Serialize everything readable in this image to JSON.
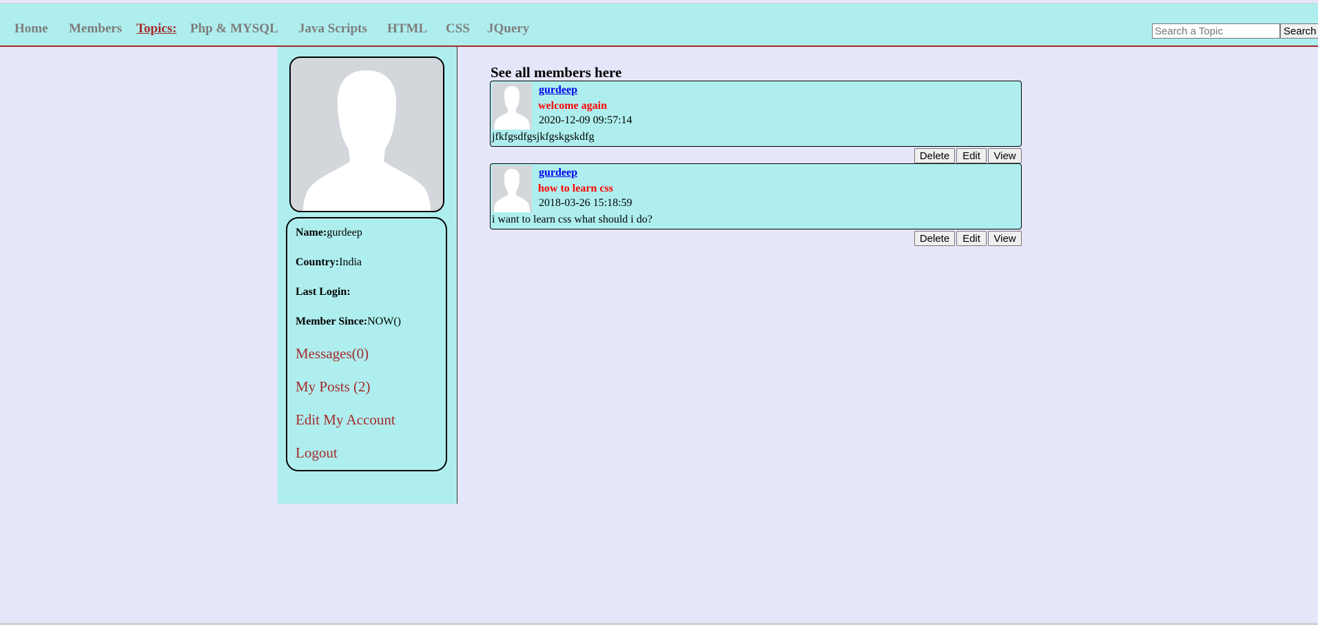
{
  "nav": {
    "home": "Home",
    "members": "Members",
    "topics": "Topics:",
    "php": "Php & MYSQL",
    "javascripts": "Java Scripts",
    "html": "HTML",
    "css": "CSS",
    "jquery": "JQuery"
  },
  "search": {
    "placeholder": "Search a Topic",
    "button": "Search"
  },
  "profile": {
    "name_label": "Name:",
    "name_value": "gurdeep",
    "country_label": "Country:",
    "country_value": "India",
    "last_login_label": "Last Login:",
    "last_login_value": "",
    "member_since_label": "Member Since:",
    "member_since_value": "NOW()",
    "links": {
      "messages": "Messages(0)",
      "my_posts": "My Posts (2)",
      "edit_account": "Edit My Account",
      "logout": "Logout"
    }
  },
  "main": {
    "heading": "See all members here",
    "posts": [
      {
        "author": "gurdeep",
        "title": "welcome again",
        "date": "2020-12-09 09:57:14",
        "body": "jfkfgsdfgsjkfgskgskdfg",
        "buttons": {
          "delete": "Delete",
          "edit": "Edit",
          "view": "View"
        }
      },
      {
        "author": "gurdeep",
        "title": "how to learn css",
        "date": "2018-03-26 15:18:59",
        "body": "i want to learn css what should i do?",
        "buttons": {
          "delete": "Delete",
          "edit": "Edit",
          "view": "View"
        }
      }
    ]
  },
  "colors": {
    "page_bg": "#e6e6fa",
    "panel_bg": "#afeeee",
    "accent": "#a52a2a",
    "post_title": "#ff0000",
    "link": "#0000ee"
  }
}
